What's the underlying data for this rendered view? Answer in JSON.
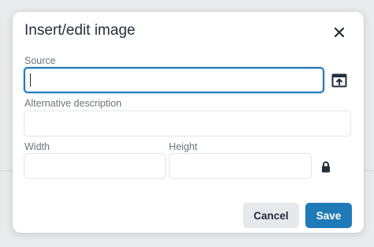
{
  "dialog": {
    "title": "Insert/edit image",
    "close_icon": "close-icon"
  },
  "fields": {
    "source": {
      "label": "Source",
      "value": ""
    },
    "alt": {
      "label": "Alternative description",
      "value": ""
    },
    "width": {
      "label": "Width",
      "value": ""
    },
    "height": {
      "label": "Height",
      "value": ""
    }
  },
  "icons": {
    "browse": "upload-icon",
    "lock": "lock-icon"
  },
  "buttons": {
    "cancel": "Cancel",
    "save": "Save"
  },
  "colors": {
    "primary": "#207ab7",
    "text": "#222f3e",
    "label": "#6b7480",
    "border": "#e1e4e8"
  }
}
